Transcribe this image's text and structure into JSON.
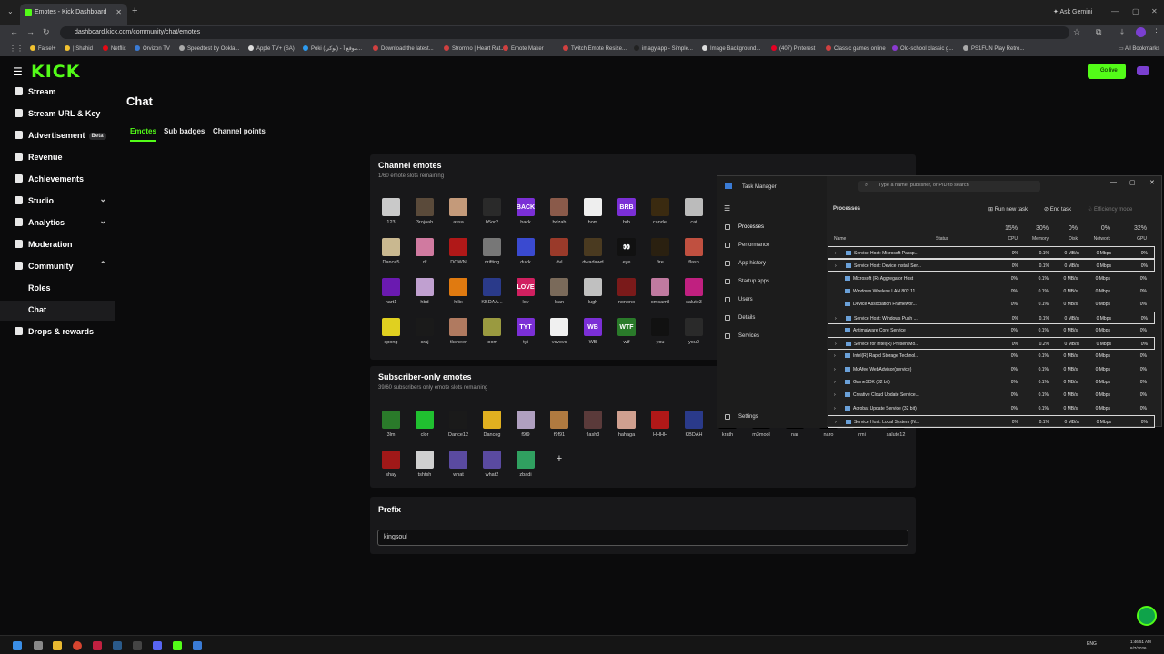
{
  "browser": {
    "tab_title": "Emotes - Kick Dashboard",
    "url": "dashboard.kick.com/community/chat/emotes",
    "ask_gemini": "Ask Gemini",
    "all_bookmarks": "All Bookmarks",
    "bookmarks": [
      {
        "label": "Faisel+",
        "color": "#f2c230"
      },
      {
        "label": "| Shahid",
        "color": "#f2c230"
      },
      {
        "label": "Netflix",
        "color": "#e50914"
      },
      {
        "label": "Orvizon TV",
        "color": "#3a7bd5"
      },
      {
        "label": "Speedtest by Ookla...",
        "color": "#aaaaaa"
      },
      {
        "label": "Apple TV+ (SA)",
        "color": "#dddddd"
      },
      {
        "label": "Poki (بوكي) - موقع أ...",
        "color": "#2d9bf0"
      },
      {
        "label": "Download the latest...",
        "color": "#d04040"
      },
      {
        "label": "Stromno | Heart Rat...",
        "color": "#d04040"
      },
      {
        "label": "Emote Maker",
        "color": "#d04040"
      },
      {
        "label": "Twitch Emote Resize...",
        "color": "#d04040"
      },
      {
        "label": "imagy.app - Simple...",
        "color": "#222222"
      },
      {
        "label": "Image Background...",
        "color": "#dddddd"
      },
      {
        "label": "(407) Pinterest",
        "color": "#e60023"
      },
      {
        "label": "Classic games online",
        "color": "#d04040"
      },
      {
        "label": "Old-school classic g...",
        "color": "#8a3ad0"
      },
      {
        "label": "PS1FUN Play Retro...",
        "color": "#aaaaaa"
      }
    ]
  },
  "kick": {
    "logo": "KICK",
    "go_live": "Go live",
    "sidebar": [
      {
        "label": "Stream",
        "icon": "stream-icon"
      },
      {
        "label": "Stream URL & Key",
        "icon": "key-icon"
      },
      {
        "label": "Advertisement",
        "icon": "ad-icon",
        "badge": "Beta"
      },
      {
        "label": "Revenue",
        "icon": "revenue-icon"
      },
      {
        "label": "Achievements",
        "icon": "trophy-icon"
      },
      {
        "label": "Studio",
        "icon": "studio-icon",
        "chevron": "⌄"
      },
      {
        "label": "Analytics",
        "icon": "analytics-icon",
        "chevron": "⌄"
      },
      {
        "label": "Moderation",
        "icon": "shield-icon"
      },
      {
        "label": "Community",
        "icon": "community-icon",
        "chevron": "⌃"
      },
      {
        "label": "Roles"
      },
      {
        "label": "Chat"
      },
      {
        "label": "Drops & rewards",
        "icon": "gift-icon"
      }
    ],
    "page_title": "Chat",
    "tabs": [
      "Emotes",
      "Sub badges",
      "Channel points"
    ],
    "channel_emotes": {
      "title": "Channel emotes",
      "subtitle": "1/60 emote slots remaining",
      "emotes": [
        {
          "name": "123",
          "color": "#c9c9c9",
          "text": ""
        },
        {
          "name": "3rojaah",
          "color": "#5a4a3a",
          "text": ""
        },
        {
          "name": "assa",
          "color": "#c49a7a",
          "text": ""
        },
        {
          "name": "b5or2",
          "color": "#2a2a2a",
          "text": ""
        },
        {
          "name": "back",
          "color": "#7b2fd6",
          "text": "BACK"
        },
        {
          "name": "bdzah",
          "color": "#8a5a4a",
          "text": ""
        },
        {
          "name": "bom",
          "color": "#eeeeee",
          "text": ""
        },
        {
          "name": "brb",
          "color": "#7b2fd6",
          "text": "BRB"
        },
        {
          "name": "candel",
          "color": "#3a2a10",
          "text": ""
        },
        {
          "name": "cat",
          "color": "#bbbbbb",
          "text": ""
        },
        {
          "name": "Dance5",
          "color": "#c9b890",
          "text": ""
        },
        {
          "name": "df",
          "color": "#d07aa0",
          "text": ""
        },
        {
          "name": "DOWN",
          "color": "#b01818",
          "text": ""
        },
        {
          "name": "drifting",
          "color": "#777777",
          "text": ""
        },
        {
          "name": "duck",
          "color": "#3a4ad0",
          "text": ""
        },
        {
          "name": "dvl",
          "color": "#9a3a2a",
          "text": ""
        },
        {
          "name": "dwadawd",
          "color": "#4a3a20",
          "text": ""
        },
        {
          "name": "eye",
          "color": "#111111",
          "text": "👀"
        },
        {
          "name": "fire",
          "color": "#2a2010",
          "text": ""
        },
        {
          "name": "flash",
          "color": "#c05040",
          "text": ""
        },
        {
          "name": "hart1",
          "color": "#6a1ab0",
          "text": ""
        },
        {
          "name": "hbd",
          "color": "#c0a0d0",
          "text": ""
        },
        {
          "name": "hilix",
          "color": "#e07a10",
          "text": ""
        },
        {
          "name": "KBDAA...",
          "color": "#2a3a8a",
          "text": ""
        },
        {
          "name": "lov",
          "color": "#d02060",
          "text": "LOVE"
        },
        {
          "name": "lsan",
          "color": "#7a6a5a",
          "text": ""
        },
        {
          "name": "lugh",
          "color": "#c0c0c0",
          "text": ""
        },
        {
          "name": "nonono",
          "color": "#7a1a1a",
          "text": ""
        },
        {
          "name": "omsamil",
          "color": "#c07aa0",
          "text": ""
        },
        {
          "name": "salute3",
          "color": "#c02080",
          "text": ""
        },
        {
          "name": "spong",
          "color": "#e0d020",
          "text": ""
        },
        {
          "name": "sraj",
          "color": "#1a1a1a",
          "text": ""
        },
        {
          "name": "tksheer",
          "color": "#b07a60",
          "text": ""
        },
        {
          "name": "toom",
          "color": "#9a9a40",
          "text": ""
        },
        {
          "name": "tyt",
          "color": "#7b2fd6",
          "text": "TYT"
        },
        {
          "name": "vcvcvc",
          "color": "#f0f0f0",
          "text": ""
        },
        {
          "name": "WB",
          "color": "#7b2fd6",
          "text": "WB"
        },
        {
          "name": "wtf",
          "color": "#2a7a2a",
          "text": "WTF"
        },
        {
          "name": "you",
          "color": "#111111",
          "text": ""
        },
        {
          "name": "you0",
          "color": "#2a2a2a",
          "text": ""
        }
      ]
    },
    "subscriber_emotes": {
      "title": "Subscriber-only emotes",
      "subtitle": "39/60 subscribers only emote slots remaining",
      "emotes": [
        {
          "name": "3lm",
          "color": "#2a7a2a",
          "text": ""
        },
        {
          "name": "clor",
          "color": "#20c030",
          "text": ""
        },
        {
          "name": "Dance12",
          "color": "#1a1a1a",
          "text": ""
        },
        {
          "name": "Danceg",
          "color": "#e0b020",
          "text": ""
        },
        {
          "name": "f9f9",
          "color": "#b0a0c0",
          "text": ""
        },
        {
          "name": "f9f91",
          "color": "#b07a40",
          "text": ""
        },
        {
          "name": "flash3",
          "color": "#5a3a3a",
          "text": ""
        },
        {
          "name": "hahaga",
          "color": "#d0a090",
          "text": ""
        },
        {
          "name": "HHHH",
          "color": "#b01818",
          "text": ""
        },
        {
          "name": "KBDAH",
          "color": "#2a3a8a",
          "text": ""
        },
        {
          "name": "krath",
          "color": "#000000",
          "text": ""
        },
        {
          "name": "m3mool",
          "color": "#000000",
          "text": ""
        },
        {
          "name": "nar",
          "color": "#000000",
          "text": ""
        },
        {
          "name": "naro",
          "color": "#000000",
          "text": ""
        },
        {
          "name": "rmi",
          "color": "#000000",
          "text": ""
        },
        {
          "name": "salute12",
          "color": "#000000",
          "text": ""
        },
        {
          "name": "shay",
          "color": "#a01818",
          "text": ""
        },
        {
          "name": "tshtsh",
          "color": "#d0d0d0",
          "text": ""
        },
        {
          "name": "what",
          "color": "#5a4aa0",
          "text": ""
        },
        {
          "name": "what2",
          "color": "#5a4aa0",
          "text": ""
        },
        {
          "name": "zbadi",
          "color": "#30a060",
          "text": ""
        }
      ],
      "add_symbol": "+"
    },
    "prefix": {
      "title": "Prefix",
      "value": "kingsoul"
    }
  },
  "task_manager": {
    "title": "Task Manager",
    "search_placeholder": "Type a name, publisher, or PID to search",
    "nav": [
      "Processes",
      "Performance",
      "App history",
      "Startup apps",
      "Users",
      "Details",
      "Services"
    ],
    "settings": "Settings",
    "section": "Processes",
    "run_new_task": "Run new task",
    "end_task": "End task",
    "efficiency_mode": "Efficiency mode",
    "columns": {
      "name": "Name",
      "status": "Status",
      "cpu_pct": "15%",
      "cpu": "CPU",
      "mem_pct": "30%",
      "mem": "Memory",
      "disk_pct": "0%",
      "disk": "Disk",
      "net_pct": "0%",
      "net": "Network",
      "gpu_pct": "32%",
      "gpu": "GPU"
    },
    "rows": [
      {
        "name": "Service Host: Microsoft Passp...",
        "cpu": "0%",
        "mem": "0.1%",
        "disk": "0 MB/s",
        "net": "0 Mbps",
        "gpu": "0%",
        "expand": true,
        "hl": true
      },
      {
        "name": "Service Host: Device Install Ser...",
        "cpu": "0%",
        "mem": "0.1%",
        "disk": "0 MB/s",
        "net": "0 Mbps",
        "gpu": "0%",
        "expand": true,
        "hl": true
      },
      {
        "name": "Microsoft (R) Aggregator Host",
        "cpu": "0%",
        "mem": "0.1%",
        "disk": "0 MB/s",
        "net": "0 Mbps",
        "gpu": "0%",
        "expand": false,
        "hl": false
      },
      {
        "name": "Windows Wireless LAN 802.11 ...",
        "cpu": "0%",
        "mem": "0.1%",
        "disk": "0 MB/s",
        "net": "0 Mbps",
        "gpu": "0%",
        "expand": false,
        "hl": false
      },
      {
        "name": "Device Association Framewor...",
        "cpu": "0%",
        "mem": "0.1%",
        "disk": "0 MB/s",
        "net": "0 Mbps",
        "gpu": "0%",
        "expand": false,
        "hl": false
      },
      {
        "name": "Service Host: Windows Push ...",
        "cpu": "0%",
        "mem": "0.1%",
        "disk": "0 MB/s",
        "net": "0 Mbps",
        "gpu": "0%",
        "expand": true,
        "hl": true
      },
      {
        "name": "Antimalware Core Service",
        "cpu": "0%",
        "mem": "0.1%",
        "disk": "0 MB/s",
        "net": "0 Mbps",
        "gpu": "0%",
        "expand": false,
        "hl": false
      },
      {
        "name": "Service for Intel(R) PresentMo...",
        "cpu": "0%",
        "mem": "0.2%",
        "disk": "0 MB/s",
        "net": "0 Mbps",
        "gpu": "0%",
        "expand": true,
        "hl": true
      },
      {
        "name": "Intel(R) Rapid Storage Technol...",
        "cpu": "0%",
        "mem": "0.1%",
        "disk": "0 MB/s",
        "net": "0 Mbps",
        "gpu": "0%",
        "expand": true,
        "hl": false
      },
      {
        "name": "McAfee WebAdvisor(service)",
        "cpu": "0%",
        "mem": "0.1%",
        "disk": "0 MB/s",
        "net": "0 Mbps",
        "gpu": "0%",
        "expand": true,
        "hl": false
      },
      {
        "name": "GameSDK (32 bit)",
        "cpu": "0%",
        "mem": "0.1%",
        "disk": "0 MB/s",
        "net": "0 Mbps",
        "gpu": "0%",
        "expand": true,
        "hl": false
      },
      {
        "name": "Creative Cloud Update Service...",
        "cpu": "0%",
        "mem": "0.1%",
        "disk": "0 MB/s",
        "net": "0 Mbps",
        "gpu": "0%",
        "expand": true,
        "hl": false
      },
      {
        "name": "Acrobat Update Service (32 bit)",
        "cpu": "0%",
        "mem": "0.1%",
        "disk": "0 MB/s",
        "net": "0 Mbps",
        "gpu": "0%",
        "expand": true,
        "hl": false
      },
      {
        "name": "Service Host: Local System (N...",
        "cpu": "0%",
        "mem": "0.1%",
        "disk": "0 MB/s",
        "net": "0 Mbps",
        "gpu": "0%",
        "expand": true,
        "hl": true
      }
    ]
  },
  "taskbar": {
    "lang": "ENG",
    "time": "1:46:51 AM",
    "date": "8/7/2026"
  }
}
